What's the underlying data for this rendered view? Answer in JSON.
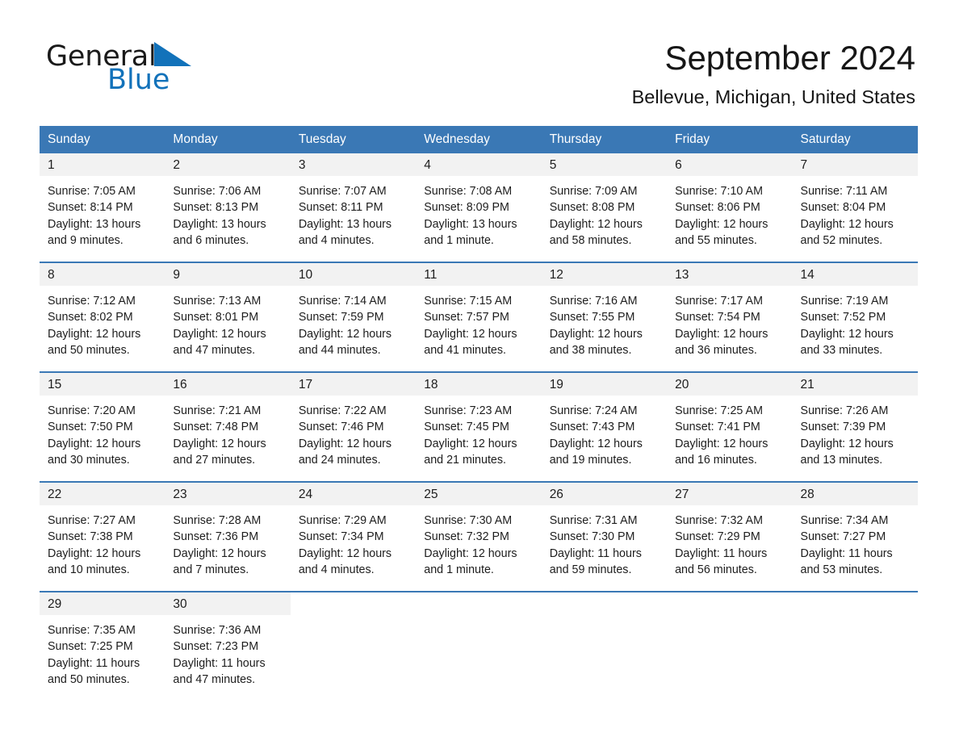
{
  "brand": {
    "name_part1": "General",
    "name_part2": "Blue",
    "accent_color": "#1272ba",
    "triangle_icon": "triangle-icon"
  },
  "header": {
    "month_title": "September 2024",
    "location": "Bellevue, Michigan, United States"
  },
  "calendar": {
    "header_bg": "#3a78b5",
    "daynum_bg": "#f2f2f2",
    "weekday_names": [
      "Sunday",
      "Monday",
      "Tuesday",
      "Wednesday",
      "Thursday",
      "Friday",
      "Saturday"
    ],
    "weeks": [
      [
        {
          "day": "1",
          "sunrise": "Sunrise: 7:05 AM",
          "sunset": "Sunset: 8:14 PM",
          "daylight_line1": "Daylight: 13 hours",
          "daylight_line2": "and 9 minutes."
        },
        {
          "day": "2",
          "sunrise": "Sunrise: 7:06 AM",
          "sunset": "Sunset: 8:13 PM",
          "daylight_line1": "Daylight: 13 hours",
          "daylight_line2": "and 6 minutes."
        },
        {
          "day": "3",
          "sunrise": "Sunrise: 7:07 AM",
          "sunset": "Sunset: 8:11 PM",
          "daylight_line1": "Daylight: 13 hours",
          "daylight_line2": "and 4 minutes."
        },
        {
          "day": "4",
          "sunrise": "Sunrise: 7:08 AM",
          "sunset": "Sunset: 8:09 PM",
          "daylight_line1": "Daylight: 13 hours",
          "daylight_line2": "and 1 minute."
        },
        {
          "day": "5",
          "sunrise": "Sunrise: 7:09 AM",
          "sunset": "Sunset: 8:08 PM",
          "daylight_line1": "Daylight: 12 hours",
          "daylight_line2": "and 58 minutes."
        },
        {
          "day": "6",
          "sunrise": "Sunrise: 7:10 AM",
          "sunset": "Sunset: 8:06 PM",
          "daylight_line1": "Daylight: 12 hours",
          "daylight_line2": "and 55 minutes."
        },
        {
          "day": "7",
          "sunrise": "Sunrise: 7:11 AM",
          "sunset": "Sunset: 8:04 PM",
          "daylight_line1": "Daylight: 12 hours",
          "daylight_line2": "and 52 minutes."
        }
      ],
      [
        {
          "day": "8",
          "sunrise": "Sunrise: 7:12 AM",
          "sunset": "Sunset: 8:02 PM",
          "daylight_line1": "Daylight: 12 hours",
          "daylight_line2": "and 50 minutes."
        },
        {
          "day": "9",
          "sunrise": "Sunrise: 7:13 AM",
          "sunset": "Sunset: 8:01 PM",
          "daylight_line1": "Daylight: 12 hours",
          "daylight_line2": "and 47 minutes."
        },
        {
          "day": "10",
          "sunrise": "Sunrise: 7:14 AM",
          "sunset": "Sunset: 7:59 PM",
          "daylight_line1": "Daylight: 12 hours",
          "daylight_line2": "and 44 minutes."
        },
        {
          "day": "11",
          "sunrise": "Sunrise: 7:15 AM",
          "sunset": "Sunset: 7:57 PM",
          "daylight_line1": "Daylight: 12 hours",
          "daylight_line2": "and 41 minutes."
        },
        {
          "day": "12",
          "sunrise": "Sunrise: 7:16 AM",
          "sunset": "Sunset: 7:55 PM",
          "daylight_line1": "Daylight: 12 hours",
          "daylight_line2": "and 38 minutes."
        },
        {
          "day": "13",
          "sunrise": "Sunrise: 7:17 AM",
          "sunset": "Sunset: 7:54 PM",
          "daylight_line1": "Daylight: 12 hours",
          "daylight_line2": "and 36 minutes."
        },
        {
          "day": "14",
          "sunrise": "Sunrise: 7:19 AM",
          "sunset": "Sunset: 7:52 PM",
          "daylight_line1": "Daylight: 12 hours",
          "daylight_line2": "and 33 minutes."
        }
      ],
      [
        {
          "day": "15",
          "sunrise": "Sunrise: 7:20 AM",
          "sunset": "Sunset: 7:50 PM",
          "daylight_line1": "Daylight: 12 hours",
          "daylight_line2": "and 30 minutes."
        },
        {
          "day": "16",
          "sunrise": "Sunrise: 7:21 AM",
          "sunset": "Sunset: 7:48 PM",
          "daylight_line1": "Daylight: 12 hours",
          "daylight_line2": "and 27 minutes."
        },
        {
          "day": "17",
          "sunrise": "Sunrise: 7:22 AM",
          "sunset": "Sunset: 7:46 PM",
          "daylight_line1": "Daylight: 12 hours",
          "daylight_line2": "and 24 minutes."
        },
        {
          "day": "18",
          "sunrise": "Sunrise: 7:23 AM",
          "sunset": "Sunset: 7:45 PM",
          "daylight_line1": "Daylight: 12 hours",
          "daylight_line2": "and 21 minutes."
        },
        {
          "day": "19",
          "sunrise": "Sunrise: 7:24 AM",
          "sunset": "Sunset: 7:43 PM",
          "daylight_line1": "Daylight: 12 hours",
          "daylight_line2": "and 19 minutes."
        },
        {
          "day": "20",
          "sunrise": "Sunrise: 7:25 AM",
          "sunset": "Sunset: 7:41 PM",
          "daylight_line1": "Daylight: 12 hours",
          "daylight_line2": "and 16 minutes."
        },
        {
          "day": "21",
          "sunrise": "Sunrise: 7:26 AM",
          "sunset": "Sunset: 7:39 PM",
          "daylight_line1": "Daylight: 12 hours",
          "daylight_line2": "and 13 minutes."
        }
      ],
      [
        {
          "day": "22",
          "sunrise": "Sunrise: 7:27 AM",
          "sunset": "Sunset: 7:38 PM",
          "daylight_line1": "Daylight: 12 hours",
          "daylight_line2": "and 10 minutes."
        },
        {
          "day": "23",
          "sunrise": "Sunrise: 7:28 AM",
          "sunset": "Sunset: 7:36 PM",
          "daylight_line1": "Daylight: 12 hours",
          "daylight_line2": "and 7 minutes."
        },
        {
          "day": "24",
          "sunrise": "Sunrise: 7:29 AM",
          "sunset": "Sunset: 7:34 PM",
          "daylight_line1": "Daylight: 12 hours",
          "daylight_line2": "and 4 minutes."
        },
        {
          "day": "25",
          "sunrise": "Sunrise: 7:30 AM",
          "sunset": "Sunset: 7:32 PM",
          "daylight_line1": "Daylight: 12 hours",
          "daylight_line2": "and 1 minute."
        },
        {
          "day": "26",
          "sunrise": "Sunrise: 7:31 AM",
          "sunset": "Sunset: 7:30 PM",
          "daylight_line1": "Daylight: 11 hours",
          "daylight_line2": "and 59 minutes."
        },
        {
          "day": "27",
          "sunrise": "Sunrise: 7:32 AM",
          "sunset": "Sunset: 7:29 PM",
          "daylight_line1": "Daylight: 11 hours",
          "daylight_line2": "and 56 minutes."
        },
        {
          "day": "28",
          "sunrise": "Sunrise: 7:34 AM",
          "sunset": "Sunset: 7:27 PM",
          "daylight_line1": "Daylight: 11 hours",
          "daylight_line2": "and 53 minutes."
        }
      ],
      [
        {
          "day": "29",
          "sunrise": "Sunrise: 7:35 AM",
          "sunset": "Sunset: 7:25 PM",
          "daylight_line1": "Daylight: 11 hours",
          "daylight_line2": "and 50 minutes."
        },
        {
          "day": "30",
          "sunrise": "Sunrise: 7:36 AM",
          "sunset": "Sunset: 7:23 PM",
          "daylight_line1": "Daylight: 11 hours",
          "daylight_line2": "and 47 minutes."
        },
        {
          "day": "",
          "sunrise": "",
          "sunset": "",
          "daylight_line1": "",
          "daylight_line2": ""
        },
        {
          "day": "",
          "sunrise": "",
          "sunset": "",
          "daylight_line1": "",
          "daylight_line2": ""
        },
        {
          "day": "",
          "sunrise": "",
          "sunset": "",
          "daylight_line1": "",
          "daylight_line2": ""
        },
        {
          "day": "",
          "sunrise": "",
          "sunset": "",
          "daylight_line1": "",
          "daylight_line2": ""
        },
        {
          "day": "",
          "sunrise": "",
          "sunset": "",
          "daylight_line1": "",
          "daylight_line2": ""
        }
      ]
    ]
  }
}
